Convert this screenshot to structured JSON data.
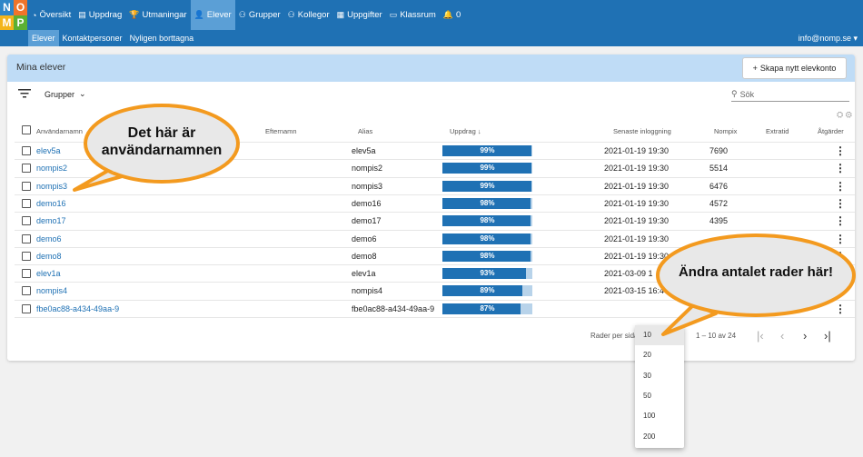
{
  "logo": {
    "n": "N",
    "o": "O",
    "m": "M",
    "p": "P"
  },
  "nav": [
    {
      "label": "Översikt",
      "icon": "dashboard-icon",
      "glyph": "◔"
    },
    {
      "label": "Uppdrag",
      "icon": "book-icon",
      "glyph": "▤"
    },
    {
      "label": "Utmaningar",
      "icon": "trophy-icon",
      "glyph": "🏆"
    },
    {
      "label": "Elever",
      "icon": "person-icon",
      "glyph": "👤",
      "active": true
    },
    {
      "label": "Grupper",
      "icon": "groups-icon",
      "glyph": "⚇"
    },
    {
      "label": "Kollegor",
      "icon": "colleagues-icon",
      "glyph": "⚇"
    },
    {
      "label": "Uppgifter",
      "icon": "grid-icon",
      "glyph": "▦"
    },
    {
      "label": "Klassrum",
      "icon": "classroom-icon",
      "glyph": "▭"
    },
    {
      "label": "0",
      "icon": "bell-icon",
      "glyph": "🔔"
    }
  ],
  "subnav": [
    {
      "label": "Elever",
      "active": true
    },
    {
      "label": "Kontaktpersoner"
    },
    {
      "label": "Nyligen borttagna"
    }
  ],
  "user_email": "info@nomp.se",
  "card": {
    "title": "Mina elever",
    "create_button": "Skapa nytt elevkonto",
    "groups_filter": "Grupper",
    "search_placeholder": "Sök"
  },
  "columns": {
    "username": "Användarnamn",
    "lastname": "Efternamn",
    "alias": "Alias",
    "assignments": "Uppdrag",
    "last_login": "Senaste inloggning",
    "nompix": "Nompix",
    "extra_time": "Extratid",
    "actions": "Åtgärder"
  },
  "rows": [
    {
      "username": "elev5a",
      "alias": "elev5a",
      "progress": 99,
      "progress_label": "99%",
      "last_login": "2021-01-19 19:30",
      "nompix": "7690"
    },
    {
      "username": "nompis2",
      "alias": "nompis2",
      "progress": 99,
      "progress_label": "99%",
      "last_login": "2021-01-19 19:30",
      "nompix": "5514"
    },
    {
      "username": "nompis3",
      "alias": "nompis3",
      "progress": 99,
      "progress_label": "99%",
      "last_login": "2021-01-19 19:30",
      "nompix": "6476"
    },
    {
      "username": "demo16",
      "alias": "demo16",
      "progress": 98,
      "progress_label": "98%",
      "last_login": "2021-01-19 19:30",
      "nompix": "4572"
    },
    {
      "username": "demo17",
      "alias": "demo17",
      "progress": 98,
      "progress_label": "98%",
      "last_login": "2021-01-19 19:30",
      "nompix": "4395"
    },
    {
      "username": "demo6",
      "alias": "demo6",
      "progress": 98,
      "progress_label": "98%",
      "last_login": "2021-01-19 19:30",
      "nompix": ""
    },
    {
      "username": "demo8",
      "alias": "demo8",
      "progress": 98,
      "progress_label": "98%",
      "last_login": "2021-01-19 19:30",
      "nompix": ""
    },
    {
      "username": "elev1a",
      "alias": "elev1a",
      "progress": 93,
      "progress_label": "93%",
      "last_login": "2021-03-09 1",
      "nompix": ""
    },
    {
      "username": "nompis4",
      "alias": "nompis4",
      "progress": 89,
      "progress_label": "89%",
      "last_login": "2021-03-15 16:4",
      "nompix": ""
    },
    {
      "username": "fbe0ac88-a434-49aa-9",
      "alias": "fbe0ac88-a434-49aa-9",
      "progress": 87,
      "progress_label": "87%",
      "last_login": "",
      "nompix": ""
    }
  ],
  "pagination": {
    "rows_per_page_label": "Rader per sida",
    "range": "1 – 10 av 24"
  },
  "rows_per_page_options": [
    "10",
    "20",
    "30",
    "50",
    "100",
    "200"
  ],
  "rows_per_page_selected": "10",
  "callouts": {
    "usernames": "Det här är användarnamnen",
    "rows": "Ändra antalet rader här!"
  },
  "colors": {
    "primary": "#1f71b4",
    "active_nav": "#5b9fd6",
    "header_bg": "#bfdcf6",
    "callout_fill": "#e8e8e8",
    "callout_border": "#f39a1f"
  }
}
